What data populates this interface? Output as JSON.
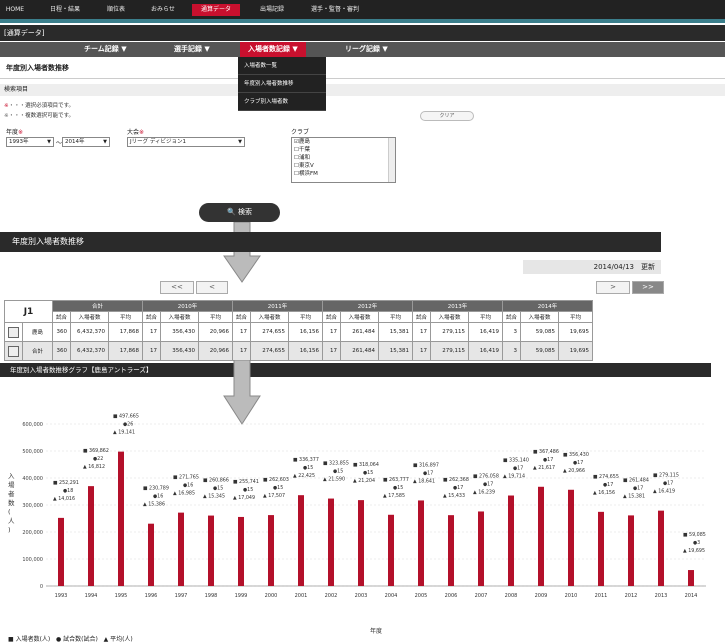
{
  "topnav": [
    "HOME",
    "日程・結果",
    "順位表",
    "おみらせ",
    "通算データ",
    "出場記録",
    "選手・監督・審判"
  ],
  "section_title": "[通算データ]",
  "subnav": [
    "チーム記録 ▼",
    "選手記録 ▼",
    "入場者数記録 ▼",
    "リーグ記録 ▼"
  ],
  "dropdown": [
    "入場者数一覧",
    "年度別入場者数推移",
    "クラブ別入場者数"
  ],
  "page_title": "年度別入場者数推移",
  "search": {
    "heading": "検索項目",
    "note_required": "・・・選択必須項目です。",
    "note_multi": "・・・複数選択可能です。",
    "clear_label": "クリア",
    "year_label": "年度",
    "year_from": "1993年",
    "year_sep": "～",
    "year_to": "2014年",
    "tournament_label": "大会",
    "tournament_value": "Jリーグ ディビジョン1",
    "club_label": "クラブ",
    "clubs": [
      "鹿島",
      "千葉",
      "浦和",
      "東京V",
      "横浜FM"
    ],
    "button_label": "検索"
  },
  "result": {
    "title": "年度別入場者数推移",
    "updated": "2014/04/13　更新",
    "pager": [
      "<<",
      "<",
      ">",
      ">>"
    ]
  },
  "table": {
    "league": "J1",
    "groups": [
      "合計",
      "2010年",
      "2011年",
      "2012年",
      "2013年",
      "2014年"
    ],
    "subheaders": [
      "試合",
      "入場者数",
      "平均"
    ],
    "rows": [
      {
        "team": "鹿島",
        "values": [
          "360",
          "6,432,370",
          "17,868",
          "17",
          "356,430",
          "20,966",
          "17",
          "274,655",
          "16,156",
          "17",
          "261,484",
          "15,381",
          "17",
          "279,115",
          "16,419",
          "3",
          "59,085",
          "19,695"
        ]
      },
      {
        "team": "合計",
        "values": [
          "360",
          "6,432,370",
          "17,868",
          "17",
          "356,430",
          "20,966",
          "17",
          "274,655",
          "16,156",
          "17",
          "261,484",
          "15,381",
          "17",
          "279,115",
          "16,419",
          "3",
          "59,085",
          "19,695"
        ]
      }
    ]
  },
  "graph_title": "年度別入場者数推移グラフ【鹿島アントラーズ】",
  "chart_data": {
    "type": "bar",
    "ylabel": "入場者数(人)",
    "xlabel": "年度",
    "ylim": [
      0,
      600000
    ],
    "yticks": [
      "0",
      "100,000",
      "200,000",
      "300,000",
      "400,000",
      "500,000",
      "600,000"
    ],
    "categories": [
      "1993",
      "1994",
      "1995",
      "1996",
      "1997",
      "1998",
      "1999",
      "2000",
      "2001",
      "2002",
      "2003",
      "2004",
      "2005",
      "2006",
      "2007",
      "2008",
      "2009",
      "2010",
      "2011",
      "2012",
      "2013",
      "2014"
    ],
    "attendance": [
      252291,
      369862,
      497665,
      230789,
      271765,
      260866,
      255741,
      262603,
      336377,
      323855,
      318064,
      263777,
      316897,
      262368,
      276058,
      335140,
      367486,
      356430,
      274655,
      261484,
      279115,
      59085
    ],
    "attendance_labels": [
      "252,291",
      "369,862",
      "497,665",
      "230,789",
      "271,765",
      "260,866",
      "255,741",
      "262,603",
      "336,377",
      "323,855",
      "318,064",
      "263,777",
      "316,897",
      "262,368",
      "276,058",
      "335,140",
      "367,486",
      "356,430",
      "274,655",
      "261,484",
      "279,115",
      "59,085"
    ],
    "games": [
      18,
      22,
      26,
      16,
      16,
      15,
      15,
      15,
      15,
      15,
      15,
      15,
      17,
      17,
      17,
      17,
      17,
      17,
      17,
      17,
      17,
      3
    ],
    "average_labels": [
      "14,016",
      "16,812",
      "19,141",
      "15,386",
      "16,985",
      "15,345",
      "17,049",
      "17,507",
      "22,425",
      "21,590",
      "21,204",
      "17,585",
      "18,641",
      "15,433",
      "16,239",
      "19,714",
      "21,617",
      "20,966",
      "16,156",
      "15,381",
      "16,419",
      "19,695"
    ],
    "legend": [
      "■ 入場者数(人)",
      "● 試合数(試合)",
      "▲ 平均(人)"
    ],
    "bar_color": "#b3102a"
  }
}
